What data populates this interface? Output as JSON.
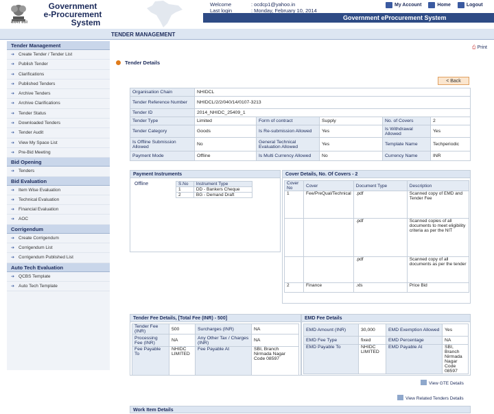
{
  "app": {
    "title_line1": "Government",
    "title_line2": "e-Procurement",
    "title_line3": "System",
    "emblem_text": "सत्यमेव जयते",
    "system_name": "Government eProcurement System"
  },
  "user": {
    "welcome_label": "Welcome",
    "welcome_value": ": ocdcp1@yahoo.in",
    "last_login_label": "Last login",
    "last_login_value": ": Monday, February 10, 2014"
  },
  "toplinks": {
    "account": "My Account",
    "home": "Home",
    "logout": "Logout"
  },
  "page": {
    "section_title": "TENDER MANAGEMENT",
    "print": "Print",
    "details_title": "Tender Details",
    "back": "< Back"
  },
  "sidebar": [
    {
      "head": "Tender Management",
      "items": [
        "Create Tender / Tender List",
        "Publish Tender",
        "Clarifications",
        "Published Tenders",
        "Archive Tenders",
        "Archive Clarifications",
        "Tender Status",
        "Downloaded Tenders",
        "Tender Audit",
        "View My Space List",
        "Pre-Bid Meeting"
      ]
    },
    {
      "head": "Bid Opening",
      "items": [
        "Tenders"
      ]
    },
    {
      "head": "Bid Evaluation",
      "items": [
        "Item Wise Evaluation",
        "Technical Evaluation",
        "Financial Evaluation",
        "AOC"
      ]
    },
    {
      "head": "Corrigendum",
      "items": [
        "Create Corrigendum",
        "Corrigendum List",
        "Corrigendum Published List"
      ]
    },
    {
      "head": "Auto Tech Evaluation",
      "items": [
        "QCBS Template",
        "Auto Tech Template"
      ]
    }
  ],
  "basic": {
    "org_label": "Organisation Chain",
    "org_value": "NHIDCL",
    "ref_label": "Tender Reference Number",
    "ref_value": "NHIDCL/2/2/040/14/0107-3213",
    "id_label": "Tender ID",
    "id_value": "2014_NHIDC_25409_1",
    "type_label": "Tender Type",
    "type_value": "Limited",
    "form_label": "Form of contract",
    "form_value": "Supply",
    "covers_label": "No. of Covers",
    "covers_value": "2",
    "cat_label": "Tender Category",
    "cat_value": "Goods",
    "resub_label": "Is Re-submission Allowed",
    "resub_value": "Yes",
    "withdraw_label": "Is Withdrawal Allowed",
    "withdraw_value": "Yes",
    "offline_label": "Is Offline Submission Allowed",
    "offline_value": "No",
    "gte_label": "General Technical Evaluation Allowed",
    "gte_value": "Yes",
    "template_label": "Template Name",
    "template_value": "Techperiodic",
    "payment_label": "Payment Mode",
    "payment_value": "Offline",
    "multicur_label": "Is Multi Currency Allowed",
    "multicur_value": "No",
    "currency_label": "Currency Name",
    "currency_value": "INR"
  },
  "payment": {
    "title": "Payment Instruments",
    "mode": "Offline",
    "headers": [
      "S.No",
      "Instrument Type"
    ],
    "rows": [
      [
        "1",
        "DD - Bankers Cheque"
      ],
      [
        "2",
        "BG - Demand Draft"
      ]
    ]
  },
  "covers": {
    "title": "Cover Details, No. Of Covers - 2",
    "headers": [
      "Cover No",
      "Cover",
      "Document Type",
      "Description"
    ],
    "rows": [
      [
        "1",
        "Fee/PreQual/Technical",
        ".pdf",
        "Scanned copy of EMD and Tender Fee"
      ],
      [
        "",
        "",
        ".pdf",
        "Scanned copies of all documents to meet eligibility criteria as per the NIT"
      ],
      [
        "",
        "",
        ".pdf",
        "Scanned copy of all documents as per the tender"
      ],
      [
        "2",
        "Finance",
        ".xls",
        "Price Bid"
      ]
    ]
  },
  "fee": {
    "title": "Tender Fee Details, [Total Fee (INR) - 500]",
    "fee_label": "Tender Fee (INR)",
    "fee_value": "500",
    "surcharge_label": "Surcharges (INR)",
    "surcharge_value": "NA",
    "proc_label": "Processing Fee (INR)",
    "proc_value": "NA",
    "other_label": "Any Other Tax / Charges (INR)",
    "other_value": "NA",
    "payto_label": "Fee Payable To",
    "payto_value": "NHIDC LIMITED",
    "payat_label": "Fee Payable At",
    "payat_value": "SBI, Branch Nirmada Nagar Code 08597"
  },
  "emd": {
    "title": "EMD Fee Details",
    "amt_label": "EMD Amount (INR)",
    "amt_value": "30,000",
    "exempt_label": "EMD Exemption Allowed",
    "exempt_value": "Yes",
    "type_label": "EMD Fee Type",
    "type_value": "fixed",
    "pct_label": "EMD Percentage",
    "pct_value": "NA",
    "payto_label": "EMD Payable To",
    "payto_value": "NHIDC LIMITED",
    "payat_label": "EMD Payable At",
    "payat_value": "SBI, Branch Nirmada Nagar Code 08597"
  },
  "links": {
    "view_gte": "View GTE Details",
    "view_related": "View Related Tenders Details"
  },
  "next_section": "Work Item Details"
}
